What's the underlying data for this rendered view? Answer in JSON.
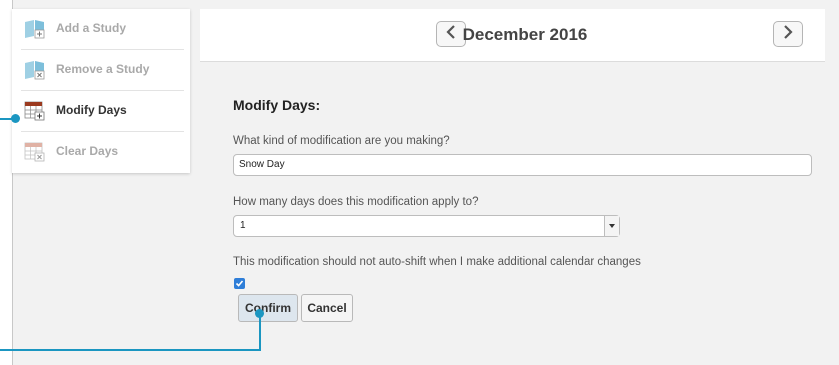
{
  "sidebar": {
    "items": [
      {
        "label": "Add a Study",
        "icon": "book-add-icon",
        "state": "disabled"
      },
      {
        "label": "Remove a Study",
        "icon": "book-remove-icon",
        "state": "disabled"
      },
      {
        "label": "Modify Days",
        "icon": "calendar-add-icon",
        "state": "active"
      },
      {
        "label": "Clear Days",
        "icon": "calendar-clear-icon",
        "state": "disabled"
      }
    ]
  },
  "header": {
    "month_title": "December 2016",
    "prev_icon": "chevron-left-icon",
    "next_icon": "chevron-right-icon"
  },
  "form": {
    "title": "Modify Days:",
    "modification_question": "What kind of modification are you making?",
    "modification_value": "Snow Day",
    "days_question": "How many days does this modification apply to?",
    "days_value": "1",
    "autoshift_label": "This modification should not auto-shift when I make additional calendar changes",
    "autoshift_checked": true,
    "confirm_label": "Confirm",
    "cancel_label": "Cancel"
  },
  "colors": {
    "accent": "#1b96c1",
    "checkbox": "#2f7ed8",
    "icon_teal": "#5fb6d6",
    "icon_calendar": "#9b3a1f"
  }
}
